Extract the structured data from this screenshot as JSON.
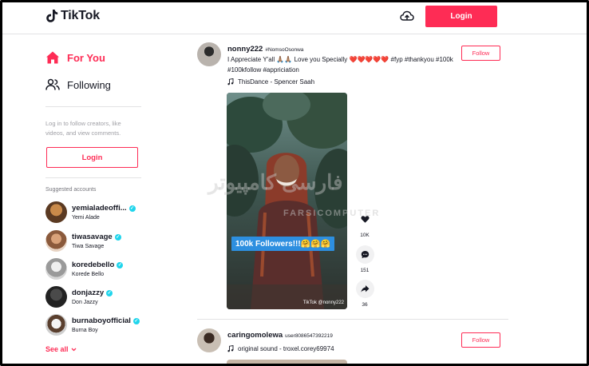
{
  "header": {
    "logo_text": "TikTok",
    "login_label": "Login",
    "upload_icon": "cloud-upload-icon"
  },
  "sidebar": {
    "nav": [
      {
        "label": "For You",
        "icon": "home-icon",
        "active": true
      },
      {
        "label": "Following",
        "icon": "people-icon",
        "active": false
      }
    ],
    "login_hint": "Log in to follow creators, like videos, and view comments.",
    "login_label": "Login",
    "suggested_title": "Suggested accounts",
    "accounts": [
      {
        "username": "yemialadeoffi...",
        "name": "Yemi Alade",
        "verified": true
      },
      {
        "username": "tiwasavage",
        "name": "Tiwa Savage",
        "verified": true
      },
      {
        "username": "koredebello",
        "name": "Korede Bello",
        "verified": true
      },
      {
        "username": "donjazzy",
        "name": "Don Jazzy",
        "verified": true
      },
      {
        "username": "burnaboyofficial",
        "name": "Burna Boy",
        "verified": true
      }
    ],
    "see_all": "See all"
  },
  "posts": [
    {
      "username": "nonny222",
      "nickname": "#NomsoOsonwa",
      "caption": "I Appreciate Y'all 🙏🏽🙏🏽 Love you Specially ❤️❤️❤️❤️❤️ #fyp #thankyou #100k #100kfollow #appriciation",
      "music": "ThisDance - Spencer Saah",
      "follow_label": "Follow",
      "video_overlay": "100k Followers!!!🤗🤗🤗",
      "video_watermark": "TikTok @nonny222",
      "likes": "10K",
      "comments": "151",
      "shares": "36"
    },
    {
      "username": "caringomolewa",
      "nickname": "user8086547392219",
      "music": "original sound - troxel.corey69974",
      "follow_label": "Follow"
    }
  ],
  "watermark": {
    "line1": "فارسی کامپیوتر",
    "line2": "FARSICOMPUTER"
  },
  "colors": {
    "accent": "#fe2c55",
    "verified": "#20d5ec",
    "text": "#161823",
    "muted": "#a0a0a6"
  }
}
